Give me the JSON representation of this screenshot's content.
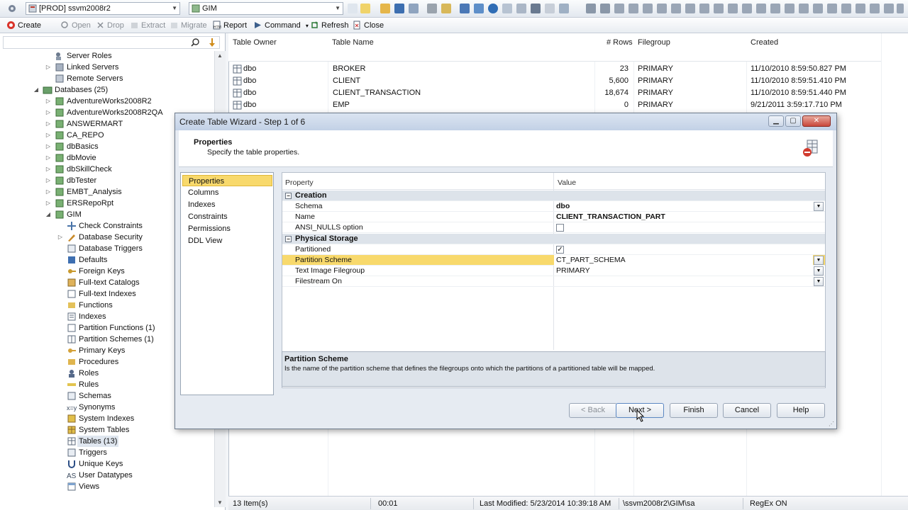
{
  "toolbar": {
    "connection_combo": "[PROD] ssvm2008r2",
    "database_combo": "GIM",
    "commands": [
      {
        "label": "Create",
        "enabled": true
      },
      {
        "label": "Open",
        "enabled": false
      },
      {
        "label": "Drop",
        "enabled": false
      },
      {
        "label": "Extract",
        "enabled": false
      },
      {
        "label": "Migrate",
        "enabled": false
      },
      {
        "label": "Report",
        "enabled": true
      },
      {
        "label": "Command",
        "enabled": true
      },
      {
        "label": "Refresh",
        "enabled": true
      },
      {
        "label": "Close",
        "enabled": true
      }
    ]
  },
  "tree": {
    "items": [
      {
        "label": "Server Roles",
        "icon": "server-roles-icon"
      },
      {
        "label": "Linked Servers",
        "icon": "linked-servers-icon"
      },
      {
        "label": "Remote Servers",
        "icon": "remote-servers-icon"
      },
      {
        "label": "Databases (25)",
        "icon": "databases-icon"
      },
      {
        "label": "AdventureWorks2008R2",
        "icon": "database-icon"
      },
      {
        "label": "AdventureWorks2008R2QA",
        "icon": "database-icon"
      },
      {
        "label": "ANSWERMART",
        "icon": "database-icon"
      },
      {
        "label": "CA_REPO",
        "icon": "database-icon"
      },
      {
        "label": "dbBasics",
        "icon": "database-icon"
      },
      {
        "label": "dbMovie",
        "icon": "database-icon"
      },
      {
        "label": "dbSkillCheck",
        "icon": "database-icon"
      },
      {
        "label": "dbTester",
        "icon": "database-icon"
      },
      {
        "label": "EMBT_Analysis",
        "icon": "database-icon"
      },
      {
        "label": "ERSRepoRpt",
        "icon": "database-icon"
      },
      {
        "label": "GIM",
        "icon": "database-icon"
      },
      {
        "label": "Check Constraints",
        "icon": "check-constraints-icon"
      },
      {
        "label": "Database Security",
        "icon": "security-icon"
      },
      {
        "label": "Database Triggers",
        "icon": "triggers-icon"
      },
      {
        "label": "Defaults",
        "icon": "defaults-icon"
      },
      {
        "label": "Foreign Keys",
        "icon": "foreign-keys-icon"
      },
      {
        "label": "Full-text Catalogs",
        "icon": "catalog-icon"
      },
      {
        "label": "Full-text Indexes",
        "icon": "fulltext-index-icon"
      },
      {
        "label": "Functions",
        "icon": "functions-icon"
      },
      {
        "label": "Indexes",
        "icon": "indexes-icon"
      },
      {
        "label": "Partition Functions (1)",
        "icon": "partition-functions-icon"
      },
      {
        "label": "Partition Schemes (1)",
        "icon": "partition-schemes-icon"
      },
      {
        "label": "Primary Keys",
        "icon": "primary-keys-icon"
      },
      {
        "label": "Procedures",
        "icon": "procedures-icon"
      },
      {
        "label": "Roles",
        "icon": "roles-icon"
      },
      {
        "label": "Rules",
        "icon": "rules-icon"
      },
      {
        "label": "Schemas",
        "icon": "schemas-icon"
      },
      {
        "label": "Synonyms",
        "icon": "synonyms-icon"
      },
      {
        "label": "System Indexes",
        "icon": "system-indexes-icon"
      },
      {
        "label": "System Tables",
        "icon": "system-tables-icon"
      },
      {
        "label": "Tables (13)",
        "icon": "tables-icon"
      },
      {
        "label": "Triggers",
        "icon": "triggers-icon"
      },
      {
        "label": "Unique Keys",
        "icon": "unique-keys-icon"
      },
      {
        "label": "User Datatypes",
        "icon": "user-datatypes-icon"
      },
      {
        "label": "Views",
        "icon": "views-icon"
      }
    ]
  },
  "grid": {
    "headers": [
      "Table Owner",
      "Table Name",
      "# Rows",
      "Filegroup",
      "Created"
    ],
    "rows": [
      [
        "dbo",
        "BROKER",
        "23",
        "PRIMARY",
        "11/10/2010 8:59:50.827 PM"
      ],
      [
        "dbo",
        "CLIENT",
        "5,600",
        "PRIMARY",
        "11/10/2010 8:59:51.410 PM"
      ],
      [
        "dbo",
        "CLIENT_TRANSACTION",
        "18,674",
        "PRIMARY",
        "11/10/2010 8:59:51.440 PM"
      ],
      [
        "dbo",
        "EMP",
        "0",
        "PRIMARY",
        "9/21/2011 3:59:17.710 PM"
      ]
    ]
  },
  "status": {
    "items_count": "13 Item(s)",
    "time": "00:01",
    "last_modified": "Last Modified: 5/23/2014 10:39:18 AM",
    "path": "\\ssvm2008r2\\GIM\\sa",
    "regex": "RegEx ON"
  },
  "dialog": {
    "title": "Create Table Wizard - Step 1 of 6",
    "header_title": "Properties",
    "header_subtitle": "Specify the table properties.",
    "nav": [
      "Properties",
      "Columns",
      "Indexes",
      "Constraints",
      "Permissions",
      "DDL View"
    ],
    "grid_header": {
      "property": "Property",
      "value": "Value"
    },
    "categories": {
      "creation": "Creation",
      "physical": "Physical Storage"
    },
    "props": {
      "schema": {
        "name": "Schema",
        "value": "dbo"
      },
      "table_name": {
        "name": "Name",
        "value": "CLIENT_TRANSACTION_PART"
      },
      "ansi_nulls": {
        "name": "ANSI_NULLS option",
        "checked": false
      },
      "partitioned": {
        "name": "Partitioned",
        "checked": true
      },
      "partition_scheme": {
        "name": "Partition Scheme",
        "value": "CT_PART_SCHEMA"
      },
      "text_image_fg": {
        "name": "Text Image Filegroup",
        "value": "PRIMARY"
      },
      "filestream_on": {
        "name": "Filestream On",
        "value": ""
      }
    },
    "desc_title": "Partition Scheme",
    "desc_text": "Is the name of the partition scheme that defines the filegroups onto which the partitions of a partitioned table will be mapped.",
    "buttons": {
      "back": "< Back",
      "next": "Next >",
      "finish": "Finish",
      "cancel": "Cancel",
      "help": "Help"
    }
  },
  "colors": {
    "accent": "#f8d96c",
    "selection": "#dfe6ef",
    "dialog_bg": "#e6ebf2"
  }
}
